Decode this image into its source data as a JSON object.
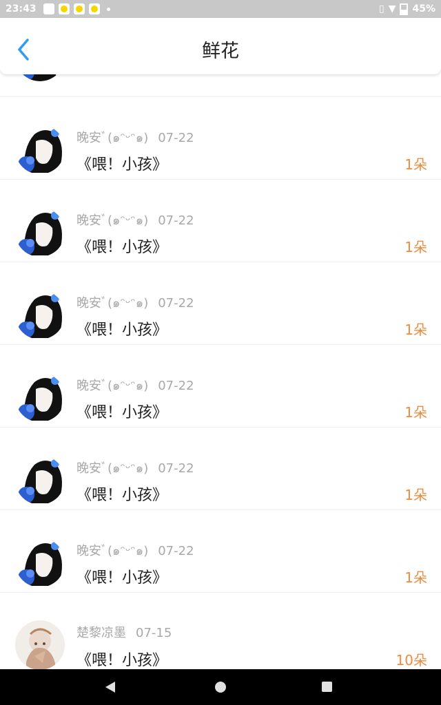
{
  "status_bar": {
    "time": "23:43",
    "battery": "45%",
    "icons": [
      "image-icon",
      "app-icon",
      "app-icon",
      "app-icon",
      "dot-icon"
    ]
  },
  "header": {
    "title": "鲜花",
    "back_icon": "chevron-left-icon",
    "accent": "#2a9df4"
  },
  "colors": {
    "count_color": "#f08a3c",
    "meta_color": "#a8a8a8"
  },
  "list": {
    "items": [
      {
        "user": "晚安ﾞ(๑ᵔᵕᵔ๑)",
        "date": "07-22",
        "work": "《喂！小孩》",
        "count": "1朵",
        "avatar": "girl-blue-flower"
      },
      {
        "user": "晚安ﾞ(๑ᵔᵕᵔ๑)",
        "date": "07-22",
        "work": "《喂！小孩》",
        "count": "1朵",
        "avatar": "girl-blue-flower"
      },
      {
        "user": "晚安ﾞ(๑ᵔᵕᵔ๑)",
        "date": "07-22",
        "work": "《喂！小孩》",
        "count": "1朵",
        "avatar": "girl-blue-flower"
      },
      {
        "user": "晚安ﾞ(๑ᵔᵕᵔ๑)",
        "date": "07-22",
        "work": "《喂！小孩》",
        "count": "1朵",
        "avatar": "girl-blue-flower"
      },
      {
        "user": "晚安ﾞ(๑ᵔᵕᵔ๑)",
        "date": "07-22",
        "work": "《喂！小孩》",
        "count": "1朵",
        "avatar": "girl-blue-flower"
      },
      {
        "user": "晚安ﾞ(๑ᵔᵕᵔ๑)",
        "date": "07-22",
        "work": "《喂！小孩》",
        "count": "1朵",
        "avatar": "girl-blue-flower"
      },
      {
        "user": "楚黎凉墨",
        "date": "07-15",
        "work": "《喂！小孩》",
        "count": "10朵",
        "avatar": "girl-painting"
      }
    ]
  },
  "nav_bar": {
    "back": "back-triangle-icon",
    "home": "home-circle-icon",
    "recent": "recent-square-icon"
  }
}
